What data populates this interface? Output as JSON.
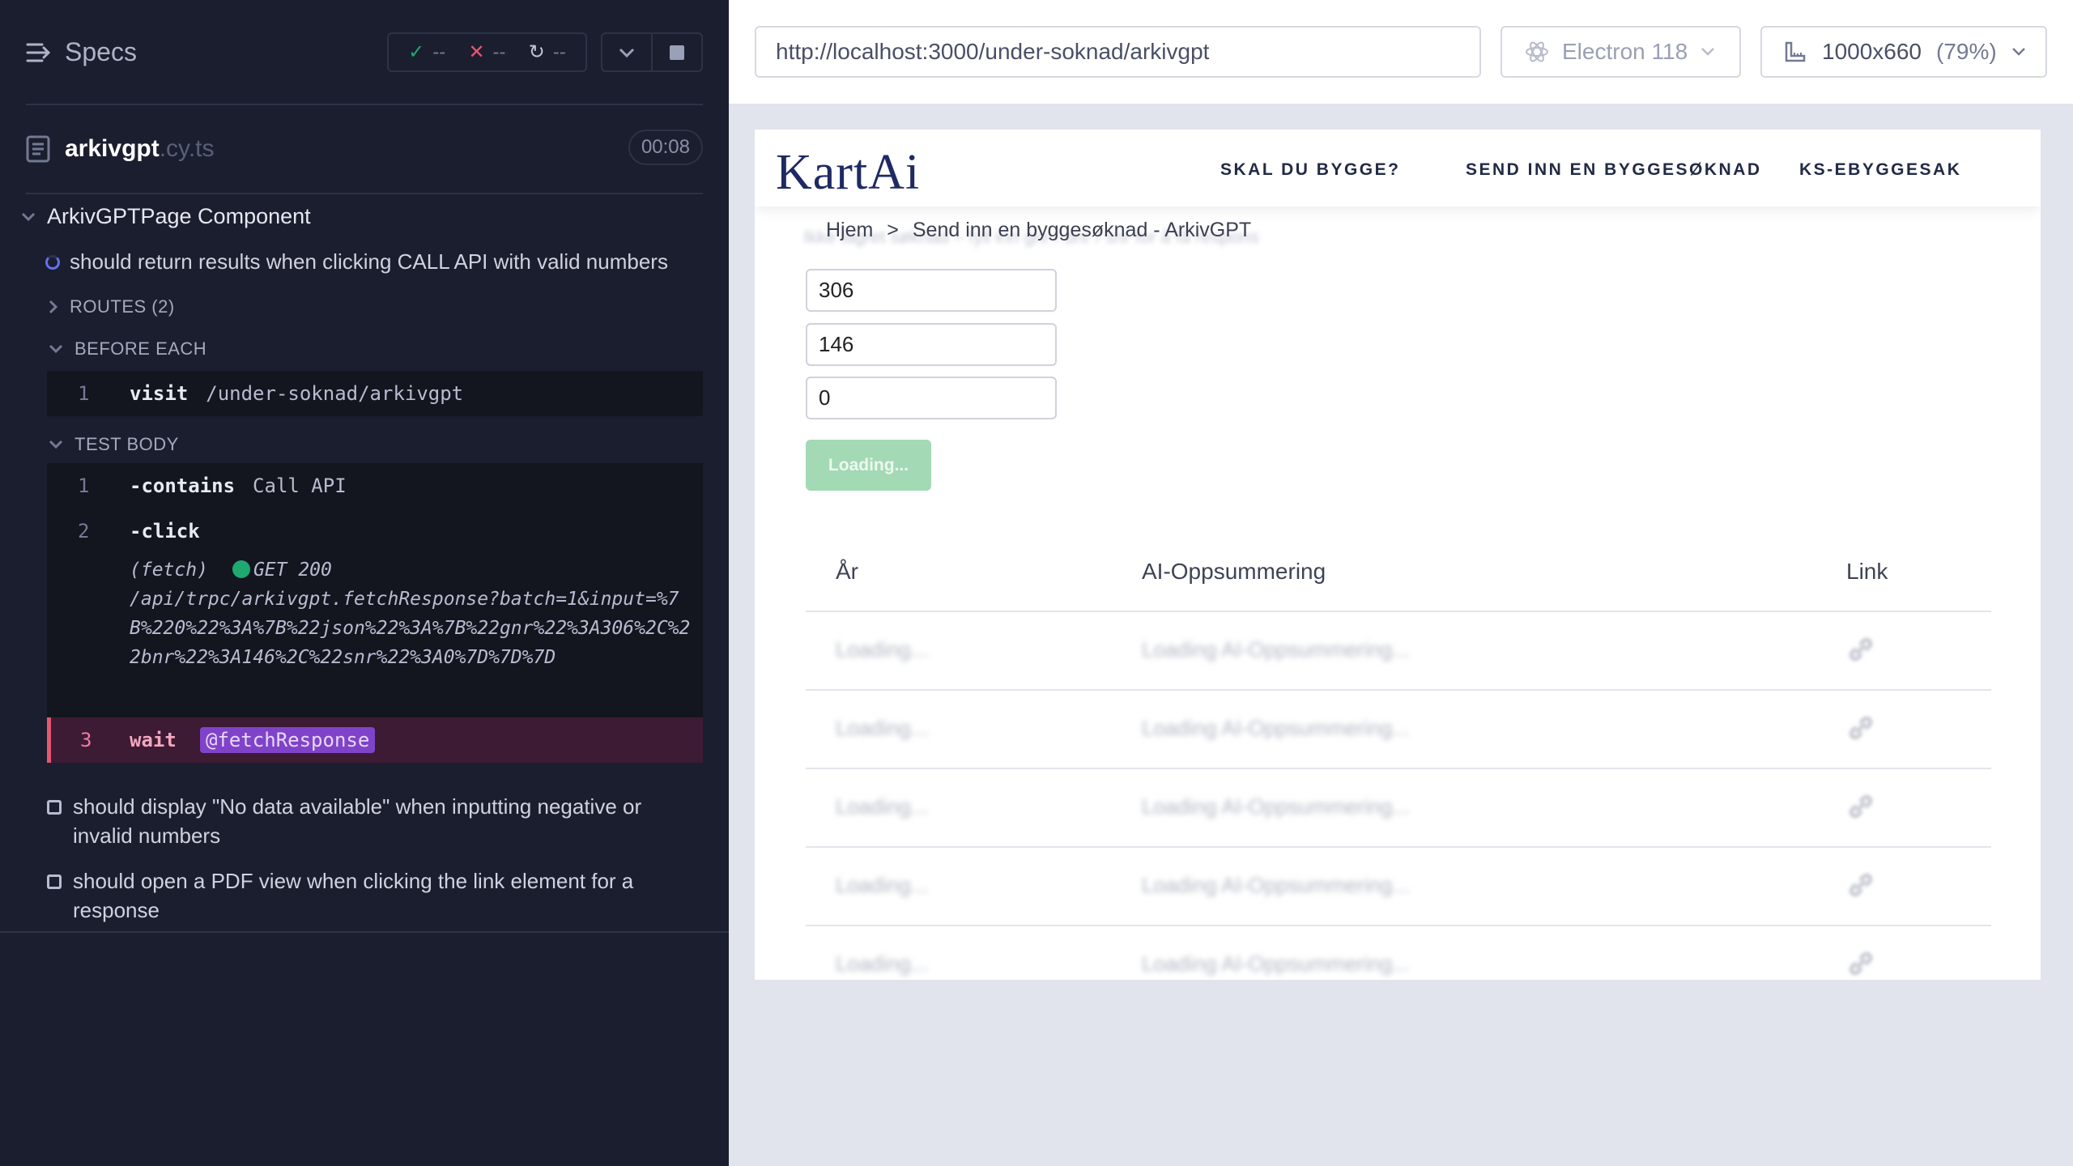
{
  "reporter": {
    "specs_label": "Specs",
    "stats": {
      "passed": "--",
      "failed": "--",
      "pending": "--"
    },
    "file": {
      "name": "arkivgpt",
      "ext": ".cy.ts",
      "timer": "00:08"
    },
    "suite": "ArkivGPTPage Component",
    "running_test": "should return results when clicking CALL API with valid numbers",
    "routes_label": "ROUTES (2)",
    "before_each_label": "BEFORE EACH",
    "before_each_cmds": [
      {
        "num": "1",
        "name": "visit",
        "arg": "/under-soknad/arkivgpt"
      }
    ],
    "test_body_label": "TEST BODY",
    "test_body_cmds": [
      {
        "num": "1",
        "name": "-contains",
        "arg": "Call API"
      },
      {
        "num": "2",
        "name": "-click",
        "arg": ""
      }
    ],
    "fetch_log": {
      "prefix": "(fetch)",
      "status": "GET 200",
      "url": "/api/trpc/arkivgpt.fetchResponse?batch=1&input=%7B%220%22%3A%7B%22json%22%3A%7B%22gnr%22%3A306%2C%22bnr%22%3A146%2C%22snr%22%3A0%7D%7D%7D"
    },
    "wait_cmd": {
      "num": "3",
      "name": "wait",
      "alias": "@fetchResponse"
    },
    "other_tests": [
      "should display \"No data available\" when inputting negative or invalid numbers",
      "should open a PDF view when clicking the link element for a response"
    ]
  },
  "aut": {
    "url": "http://localhost:3000/under-soknad/arkivgpt",
    "browser": "Electron 118",
    "viewport": "1000x660",
    "zoom": "(79%)",
    "app": {
      "logo": "KartAi",
      "nav": [
        "SKAL DU BYGGE?",
        "SEND INN EN BYGGESØKNAD",
        "KS-EBYGGESAK"
      ],
      "breadcrumb": {
        "home": "Hjem",
        "sep": ">",
        "current": "Send inn en byggesøknad - ArkivGPT"
      },
      "ghost_text": "Ikke lagret søknad – fyll inn gnr / bnr / snr for å få respons",
      "inputs": [
        "306",
        "146",
        "0"
      ],
      "button": "Loading...",
      "table": {
        "headers": [
          "År",
          "AI-Oppsummering",
          "Link"
        ],
        "rows": [
          {
            "year": "Loading...",
            "summary": "Loading AI-Oppsummering..."
          },
          {
            "year": "Loading...",
            "summary": "Loading AI-Oppsummering..."
          },
          {
            "year": "Loading...",
            "summary": "Loading AI-Oppsummering..."
          },
          {
            "year": "Loading...",
            "summary": "Loading AI-Oppsummering..."
          },
          {
            "year": "Loading...",
            "summary": "Loading AI-Oppsummering..."
          }
        ]
      }
    }
  },
  "colors": {
    "reporter_bg": "#1b1e2e",
    "pass": "#1fa971",
    "fail": "#e45770",
    "alias": "#7f43c9",
    "loading_button": "#a3d9b4"
  }
}
